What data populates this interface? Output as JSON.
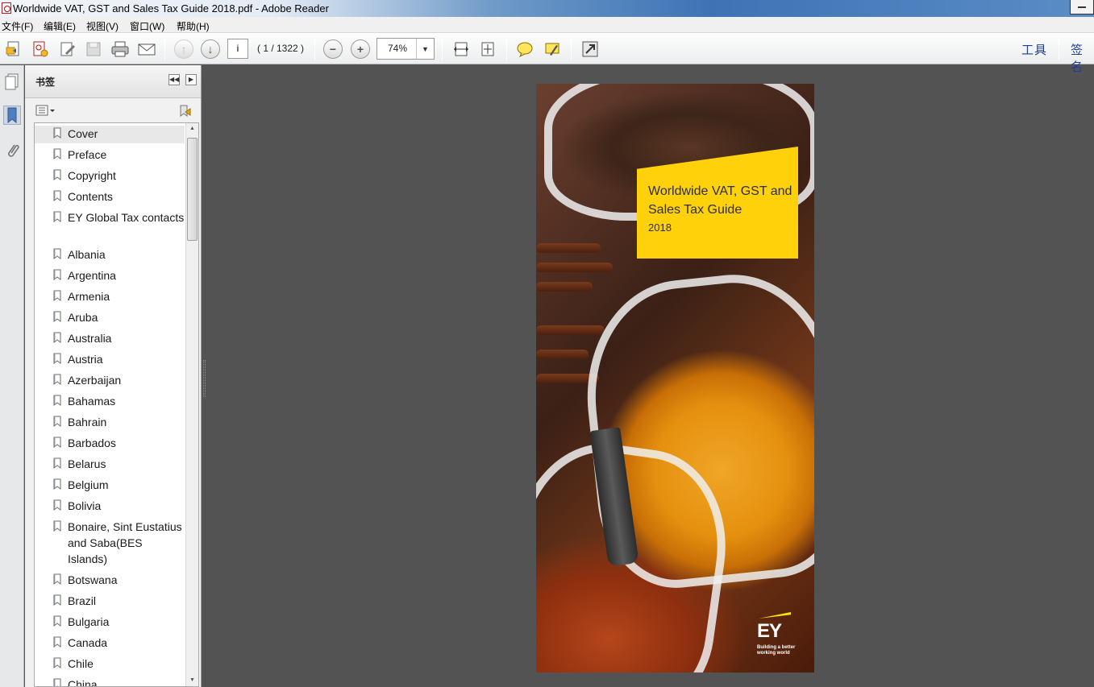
{
  "window": {
    "title": "Worldwide VAT, GST and Sales Tax Guide 2018.pdf - Adobe Reader"
  },
  "menu": [
    "文件(F)",
    "编辑(E)",
    "视图(V)",
    "窗口(W)",
    "帮助(H)"
  ],
  "toolbar": {
    "page_input": "i",
    "page_count": "( 1 / 1322 )",
    "zoom": "74%",
    "tools_label": "工具",
    "sign_label": "签名"
  },
  "panel": {
    "title": "书签",
    "bookmarks": [
      "Cover",
      "Preface",
      "Copyright",
      "Contents",
      "EY Global Tax contacts",
      "Albania",
      "Argentina",
      "Armenia",
      "Aruba",
      "Australia",
      "Austria",
      "Azerbaijan",
      "Bahamas",
      "Bahrain",
      "Barbados",
      "Belarus",
      "Belgium",
      "Bolivia",
      "Bonaire, Sint Eustatius and Saba(BES Islands)",
      "Botswana",
      "Brazil",
      "Bulgaria",
      "Canada",
      "Chile",
      "China"
    ]
  },
  "document": {
    "cover_title": "Worldwide VAT, GST and Sales Tax Guide",
    "cover_year": "2018",
    "logo_text": "EY",
    "logo_tagline": "Building a better working world"
  },
  "colors": {
    "accent_yellow": "#ffd10a",
    "ey_yellow": "#ffe600",
    "canvas_gray": "#535353"
  }
}
